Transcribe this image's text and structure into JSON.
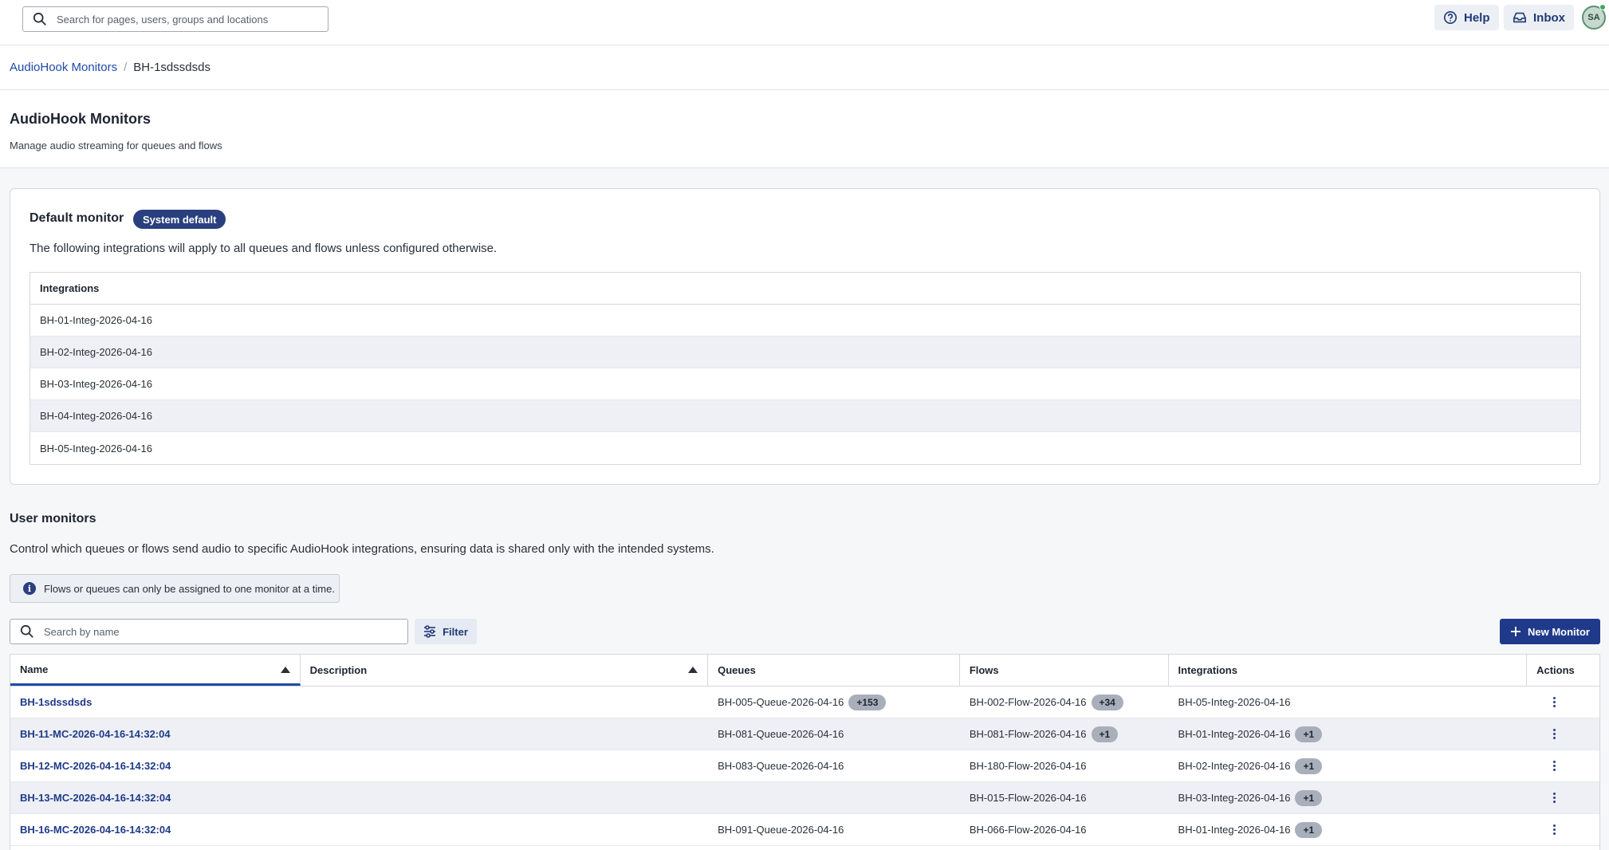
{
  "topbar": {
    "search_placeholder": "Search for pages, users, groups and locations",
    "help_label": "Help",
    "inbox_label": "Inbox",
    "avatar_initials": "SA"
  },
  "breadcrumb": {
    "parent": "AudioHook Monitors",
    "separator": "/",
    "current": "BH-1sdssdsds"
  },
  "page": {
    "title": "AudioHook Monitors",
    "subtitle": "Manage audio streaming for queues and flows"
  },
  "default_monitor": {
    "title": "Default monitor",
    "badge": "System default",
    "description": "The following integrations will apply to all queues and flows unless configured otherwise.",
    "table_header": "Integrations",
    "integrations": [
      "BH-01-Integ-2026-04-16",
      "BH-02-Integ-2026-04-16",
      "BH-03-Integ-2026-04-16",
      "BH-04-Integ-2026-04-16",
      "BH-05-Integ-2026-04-16"
    ]
  },
  "user_monitors": {
    "title": "User monitors",
    "description": "Control which queues or flows send audio to specific AudioHook integrations, ensuring data is shared only with the intended systems.",
    "notice": "Flows or queues can only be assigned to one monitor at a time.",
    "search_placeholder": "Search by name",
    "filter_label": "Filter",
    "new_button_label": "New Monitor",
    "columns": [
      "Name",
      "Description",
      "Queues",
      "Flows",
      "Integrations",
      "Actions"
    ],
    "rows": [
      {
        "name": "BH-1sdssdsds",
        "description": "",
        "queue": "BH-005-Queue-2026-04-16",
        "queue_more": "+153",
        "flow": "BH-002-Flow-2026-04-16",
        "flow_more": "+34",
        "integration": "BH-05-Integ-2026-04-16",
        "integration_more": ""
      },
      {
        "name": "BH-11-MC-2026-04-16-14:32:04",
        "description": "",
        "queue": "BH-081-Queue-2026-04-16",
        "queue_more": "",
        "flow": "BH-081-Flow-2026-04-16",
        "flow_more": "+1",
        "integration": "BH-01-Integ-2026-04-16",
        "integration_more": "+1"
      },
      {
        "name": "BH-12-MC-2026-04-16-14:32:04",
        "description": "",
        "queue": "BH-083-Queue-2026-04-16",
        "queue_more": "",
        "flow": "BH-180-Flow-2026-04-16",
        "flow_more": "",
        "integration": "BH-02-Integ-2026-04-16",
        "integration_more": "+1"
      },
      {
        "name": "BH-13-MC-2026-04-16-14:32:04",
        "description": "",
        "queue": "",
        "queue_more": "",
        "flow": "BH-015-Flow-2026-04-16",
        "flow_more": "",
        "integration": "BH-03-Integ-2026-04-16",
        "integration_more": "+1"
      },
      {
        "name": "BH-16-MC-2026-04-16-14:32:04",
        "description": "",
        "queue": "BH-091-Queue-2026-04-16",
        "queue_more": "",
        "flow": "BH-066-Flow-2026-04-16",
        "flow_more": "",
        "integration": "BH-01-Integ-2026-04-16",
        "integration_more": "+1"
      }
    ]
  }
}
